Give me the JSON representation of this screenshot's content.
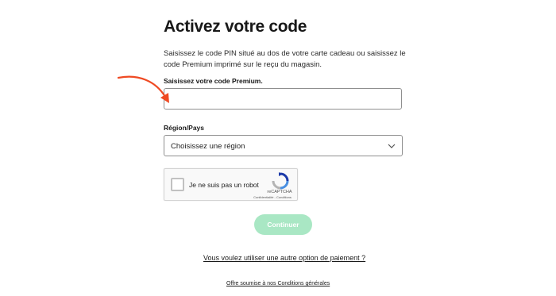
{
  "header": {
    "title": "Activez votre code"
  },
  "intro": {
    "description": "Saisissez le code PIN situé au dos de votre carte cadeau ou saisissez le code Premium imprimé sur le reçu du magasin."
  },
  "code_field": {
    "label": "Saisissez votre code Premium.",
    "value": "",
    "placeholder": ""
  },
  "region_field": {
    "label": "Région/Pays",
    "selected": "Choisissez une région"
  },
  "captcha": {
    "label": "Je ne suis pas un robot",
    "brand": "reCAPTCHA",
    "links": "Confidentialité - Conditions",
    "checked": false
  },
  "actions": {
    "continue_label": "Continuer"
  },
  "links": {
    "other_payment": "Vous voulez utiliser une autre option de paiement ?",
    "terms": "Offre soumise à nos Conditions générales"
  },
  "icons": {
    "annotation": "arrow-icon",
    "select": "chevron-down-icon",
    "captcha": "recaptcha-icon"
  },
  "colors": {
    "annotation_arrow": "#ef4a23",
    "continue_button": "#a9e7c4",
    "input_border": "#8f8f8f"
  }
}
